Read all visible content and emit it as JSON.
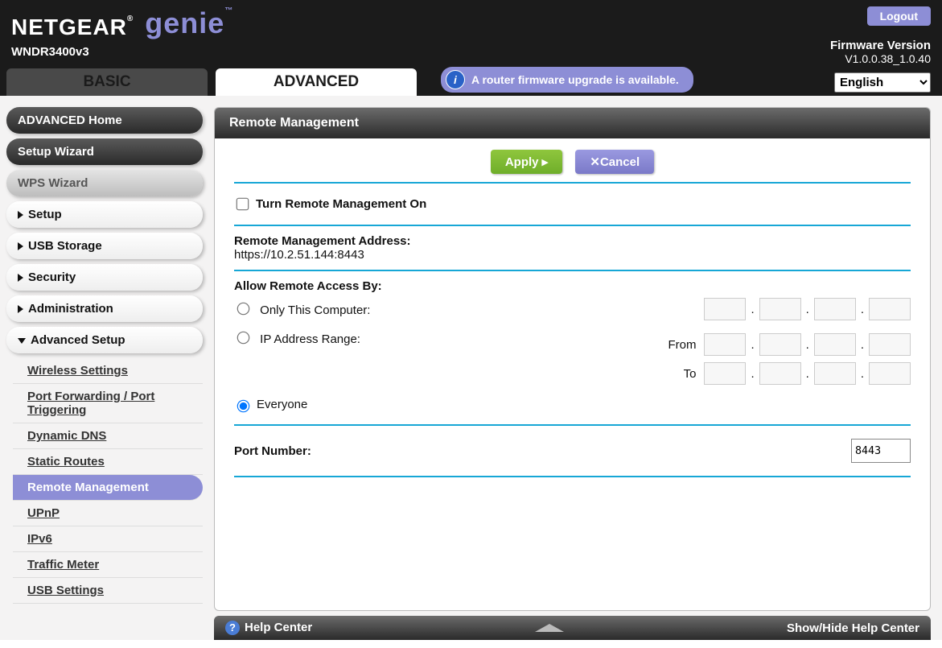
{
  "header": {
    "brand_a": "NETGEAR",
    "brand_b": "genie",
    "brand_tm": "™",
    "model": "WNDR3400v3",
    "logout": "Logout",
    "fw_label": "Firmware Version",
    "fw_value": "V1.0.0.38_1.0.40"
  },
  "tabs": {
    "basic": "BASIC",
    "advanced": "ADVANCED"
  },
  "notice": "A router firmware upgrade is available.",
  "language": {
    "selected": "English",
    "options": [
      "English"
    ]
  },
  "sidebar": {
    "adv_home": "ADVANCED Home",
    "setup_wizard": "Setup Wizard",
    "wps_wizard": "WPS Wizard",
    "setup": "Setup",
    "usb_storage": "USB Storage",
    "security": "Security",
    "administration": "Administration",
    "advanced_setup": "Advanced Setup",
    "sub": {
      "wireless": "Wireless Settings",
      "portfw": "Port Forwarding / Port Triggering",
      "ddns": "Dynamic DNS",
      "routes": "Static Routes",
      "remote": "Remote Management",
      "upnp": "UPnP",
      "ipv6": "IPv6",
      "traffic": "Traffic Meter",
      "usb": "USB Settings"
    }
  },
  "panel": {
    "title": "Remote Management",
    "apply": "Apply ▸",
    "cancel": "Cancel",
    "turn_on": "Turn Remote Management On",
    "addr_label": "Remote Management Address:",
    "addr_value": "https://10.2.51.144:8443",
    "allow_label": "Allow Remote Access By:",
    "only_this": "Only This Computer:",
    "ip_range": "IP Address Range:",
    "from": "From",
    "to": "To",
    "everyone": "Everyone",
    "port_label": "Port Number:",
    "port_value": "8443"
  },
  "footer": {
    "help_center": "Help Center",
    "showhide": "Show/Hide Help Center"
  }
}
